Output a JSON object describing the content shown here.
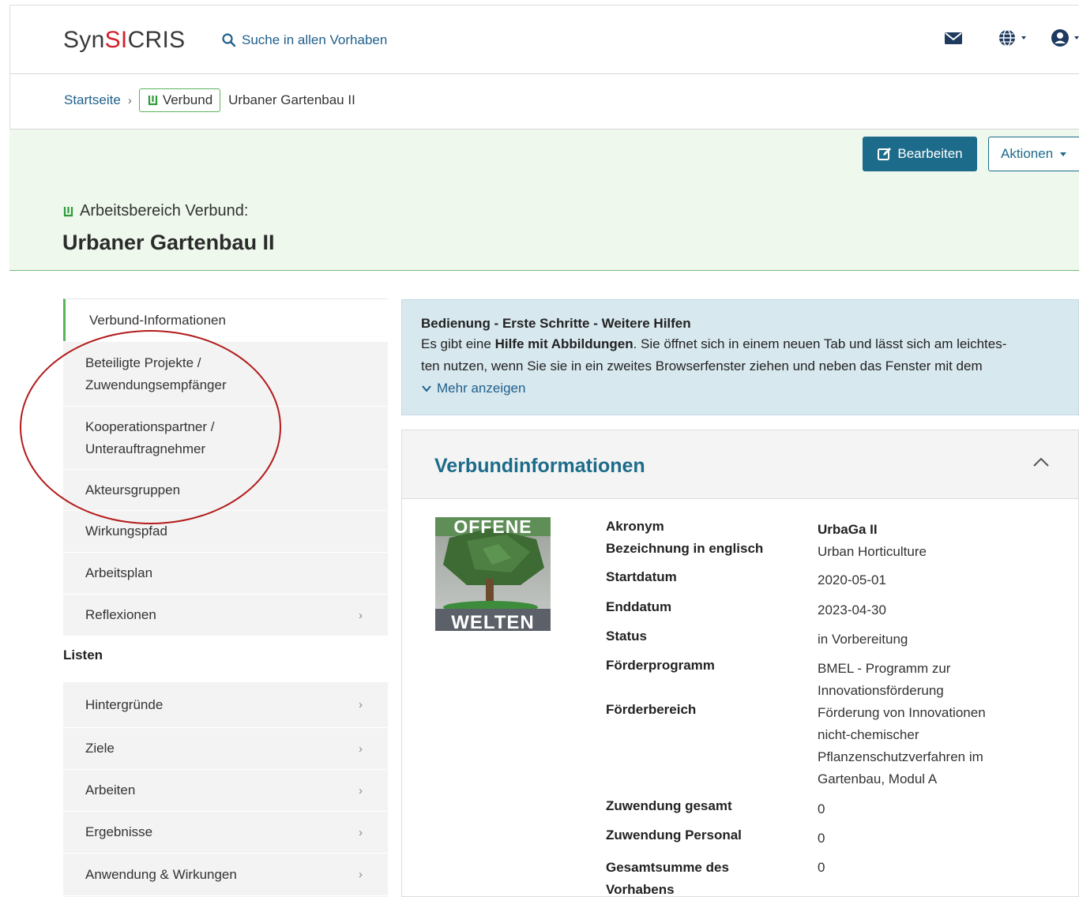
{
  "navbar": {
    "brand_prefix": "Syn",
    "brand_accent": "SI",
    "brand_suffix": "CRIS",
    "search_label": "Suche in allen Vorhaben",
    "icons": [
      "mail-icon",
      "globe-icon",
      "user-icon"
    ]
  },
  "breadcrumb": {
    "home": "Startseite",
    "badge": "Verbund",
    "current": "Urbaner Gartenbau II"
  },
  "header": {
    "edit_button": "Bearbeiten",
    "actions_button": "Aktionen",
    "subtitle": "Arbeitsbereich Verbund:",
    "title": "Urbaner Gartenbau II"
  },
  "sidebar": {
    "items": [
      {
        "label": "Verbund-Informationen"
      },
      {
        "label_1": "Beteiligte Projekte /",
        "label_2": "Zuwendungsempfänger"
      },
      {
        "label_1": "Kooperationspartner /",
        "label_2": "Unterauftragnehmer"
      },
      {
        "label": "Akteursgruppen"
      },
      {
        "label": "Wirkungspfad"
      },
      {
        "label": "Arbeitsplan"
      },
      {
        "label": "Reflexionen"
      }
    ],
    "lists_heading": "Listen",
    "lists": [
      {
        "label": "Hintergründe"
      },
      {
        "label": "Ziele"
      },
      {
        "label": "Arbeiten"
      },
      {
        "label": "Ergebnisse"
      },
      {
        "label": "Anwendung & Wirkungen"
      }
    ]
  },
  "infobox": {
    "title": "Bedienung - Erste Schritte - Weitere Hilfen",
    "line1_pre": "Es gibt eine ",
    "line1_bold": "Hilfe mit Abbildungen",
    "line1_post": ". Sie öffnet sich in einem neuen Tab und lässt sich am leichtes-",
    "line2": "ten nutzen, wenn Sie sie in ein zweites Browserfenster ziehen und neben das Fenster mit dem",
    "more": "Mehr anzeigen"
  },
  "card": {
    "title": "Verbundinformationen",
    "logo_top": "OFFENE",
    "logo_bottom": "WELTEN",
    "fields": [
      {
        "label": "Akronym",
        "value": "UrbaGa II"
      },
      {
        "label": "Bezeichnung in englisch",
        "value": "Urban Horticulture"
      },
      {
        "label": "Startdatum",
        "value": "2020-05-01"
      },
      {
        "label": "Enddatum",
        "value": "2023-04-30"
      },
      {
        "label": "Status",
        "value": "in Vorbereitung"
      },
      {
        "label": "Förderprogramm",
        "value": "BMEL - Programm zur Innovationsförderung"
      },
      {
        "label": "Förderbereich",
        "value": "Förderung von Innovationen nicht-chemischer Pflanzenschutzverfahren im Gartenbau, Modul A"
      },
      {
        "label": "Zuwendung gesamt",
        "value": "0"
      },
      {
        "label": "Zuwendung Personal",
        "value": "0"
      },
      {
        "label": "Gesamtsumme des Vorhabens",
        "value": "0"
      }
    ]
  },
  "colors": {
    "accent": "#1d6b8a",
    "brand_red": "#d21f2a",
    "verbund_green": "#58b55a",
    "header_bg": "#eef8ec",
    "annotation_circle": "#b31b1b"
  }
}
